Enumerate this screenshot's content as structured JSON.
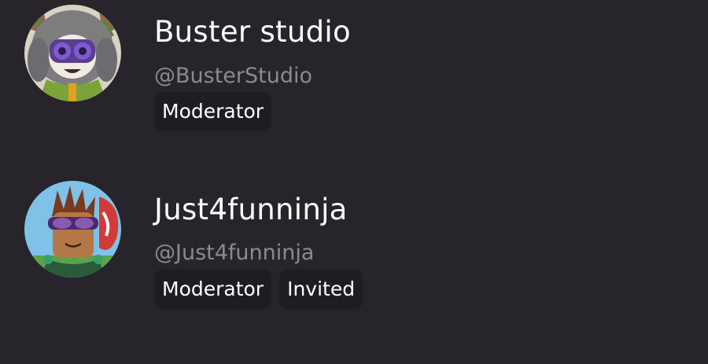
{
  "members": [
    {
      "display_name": "Buster studio",
      "handle": "@BusterStudio",
      "badges": [
        "Moderator"
      ]
    },
    {
      "display_name": "Just4funninja",
      "handle": "@Just4funninja",
      "badges": [
        "Moderator",
        "Invited"
      ]
    }
  ],
  "colors": {
    "background": "#27252b",
    "badge_background": "#1e1d22",
    "handle_text": "#8c8a90"
  }
}
